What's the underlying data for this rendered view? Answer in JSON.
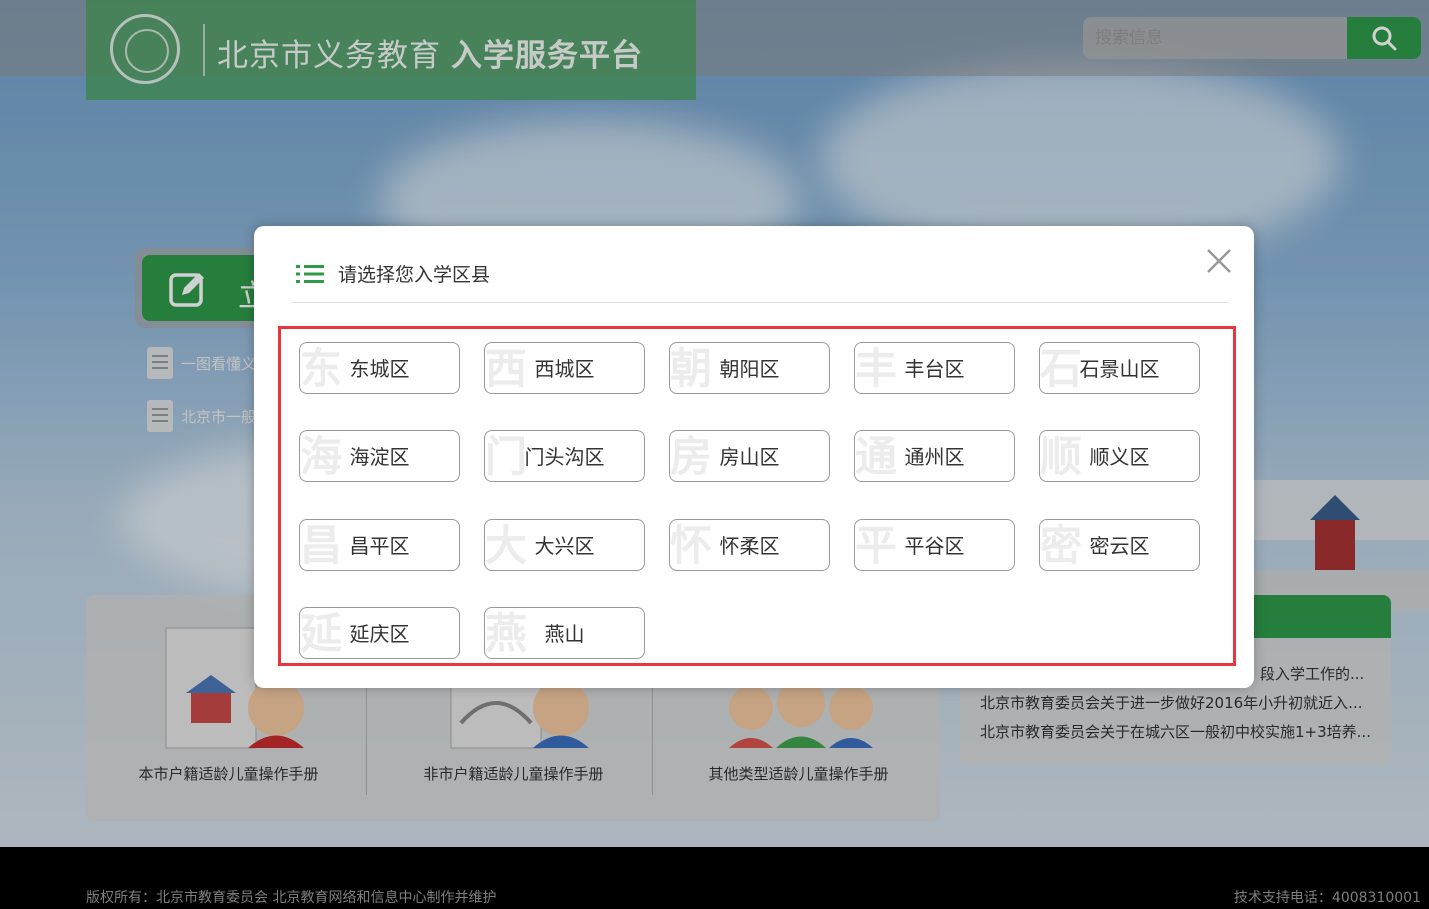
{
  "header": {
    "title_main": "北京市义务教育",
    "title_bold": "入学服务平台",
    "search_placeholder": "搜索信息"
  },
  "apply": {
    "label": "立"
  },
  "side_links": [
    "一图看懂义",
    "北京市一般"
  ],
  "guides": [
    {
      "caption": "本市户籍适龄儿童操作手册"
    },
    {
      "caption": "非市户籍适龄儿童操作手册"
    },
    {
      "caption": "其他类型适龄儿童操作手册"
    }
  ],
  "news": [
    "段入学工作的...",
    "北京市教育委员会关于进一步做好2016年小升初就近入...",
    "北京市教育委员会关于在城六区一般初中校实施1+3培养..."
  ],
  "footer": {
    "copyright": "版权所有：北京市教育委员会 北京教育网络和信息中心制作并维护",
    "tel": "技术支持电话：4008310001"
  },
  "modal": {
    "title": "请选择您入学区县",
    "districts": [
      {
        "name": "东城区",
        "watermark": "东"
      },
      {
        "name": "西城区",
        "watermark": "西"
      },
      {
        "name": "朝阳区",
        "watermark": "朝"
      },
      {
        "name": "丰台区",
        "watermark": "丰"
      },
      {
        "name": "石景山区",
        "watermark": "石"
      },
      {
        "name": "海淀区",
        "watermark": "海"
      },
      {
        "name": "门头沟区",
        "watermark": "门"
      },
      {
        "name": "房山区",
        "watermark": "房"
      },
      {
        "name": "通州区",
        "watermark": "通"
      },
      {
        "name": "顺义区",
        "watermark": "顺"
      },
      {
        "name": "昌平区",
        "watermark": "昌"
      },
      {
        "name": "大兴区",
        "watermark": "大"
      },
      {
        "name": "怀柔区",
        "watermark": "怀"
      },
      {
        "name": "平谷区",
        "watermark": "平"
      },
      {
        "name": "密云区",
        "watermark": "密"
      },
      {
        "name": "延庆区",
        "watermark": "延"
      },
      {
        "name": "燕山",
        "watermark": "燕"
      }
    ]
  },
  "colors": {
    "brand_green": "#2f9a4a",
    "highlight_red": "#e5383e"
  },
  "icons": [
    "search-icon",
    "edit-icon",
    "document-icon",
    "list-icon",
    "close-icon"
  ]
}
